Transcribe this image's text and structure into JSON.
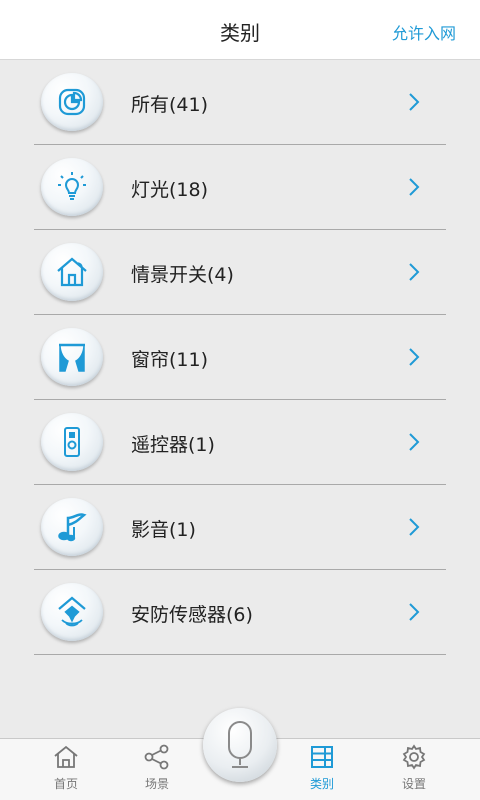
{
  "header": {
    "title": "类别",
    "action": "允许入网"
  },
  "categories": [
    {
      "label": "所有(41)",
      "icon": "pie-chart-icon"
    },
    {
      "label": "灯光(18)",
      "icon": "light-bulb-icon"
    },
    {
      "label": "情景开关(4)",
      "icon": "home-scene-icon"
    },
    {
      "label": "窗帘(11)",
      "icon": "curtain-icon"
    },
    {
      "label": "遥控器(1)",
      "icon": "remote-control-icon"
    },
    {
      "label": "影音(1)",
      "icon": "music-note-icon"
    },
    {
      "label": "安防传感器(6)",
      "icon": "security-sensor-icon"
    }
  ],
  "tabbar": {
    "items": [
      {
        "label": "首页",
        "icon": "home-icon"
      },
      {
        "label": "场景",
        "icon": "share-icon"
      },
      {
        "label": "类别",
        "icon": "category-list-icon",
        "active": true
      },
      {
        "label": "设置",
        "icon": "gear-icon"
      }
    ],
    "center_icon": "microphone-icon"
  },
  "colors": {
    "accent": "#1f9ad6",
    "background": "#ebebeb",
    "divider": "#a9a9a9"
  }
}
